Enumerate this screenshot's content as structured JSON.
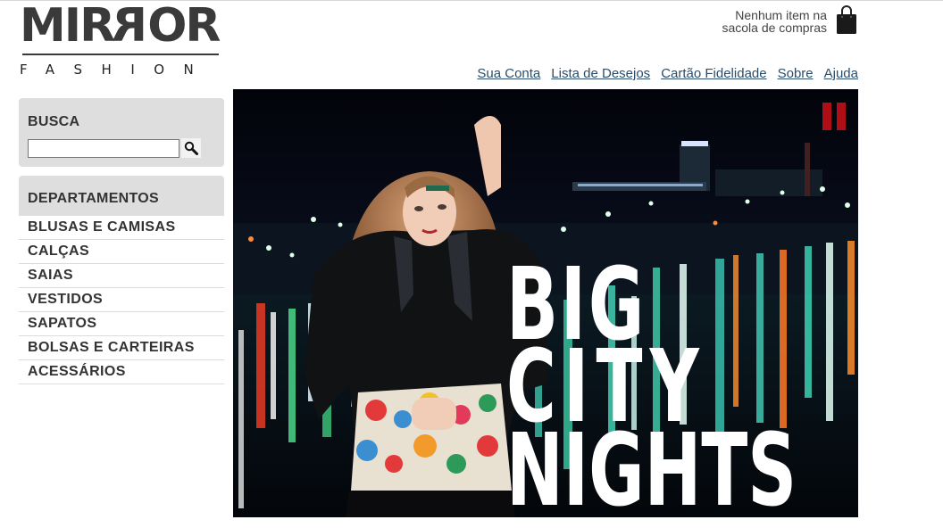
{
  "logo": {
    "main": [
      "M",
      "I",
      "R",
      "R",
      "O",
      "R"
    ],
    "sub": "FASHION"
  },
  "cart": {
    "line1": "Nenhum item na",
    "line2": "sacola de compras",
    "icon": "shopping-bag-icon"
  },
  "top_links": [
    "Sua Conta",
    "Lista de Desejos",
    "Cartão Fidelidade",
    "Sobre",
    "Ajuda"
  ],
  "search": {
    "title": "BUSCA",
    "value": "",
    "button_icon": "magnifier-icon"
  },
  "departments": {
    "title": "DEPARTAMENTOS",
    "items": [
      "BLUSAS E CAMISAS",
      "CALÇAS",
      "SAIAS",
      "VESTIDOS",
      "SAPATOS",
      "BOLSAS E CARTEIRAS",
      "ACESSÁRIOS"
    ]
  },
  "banner": {
    "headline": [
      "BIG",
      "CITY",
      "NIGHTS"
    ],
    "pause_icon": "pause-icon",
    "accent_color": "#b00e16"
  }
}
